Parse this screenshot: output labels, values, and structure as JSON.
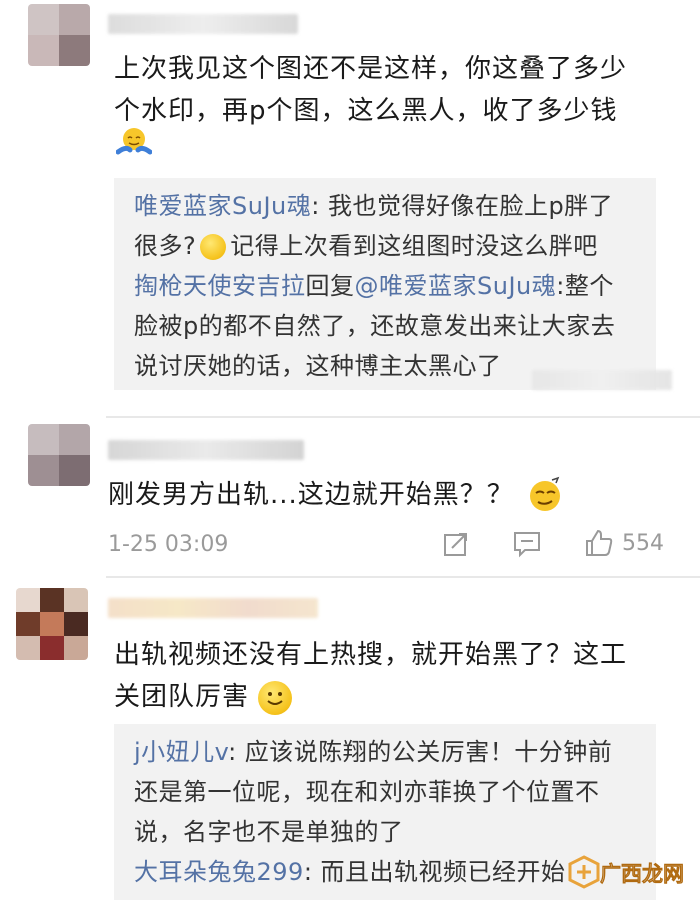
{
  "comment1": {
    "text_line1": "上次我见这个图还不是这样，你这叠了多少",
    "text_line2": "个水印，再p个图，这么黑人，收了多少钱",
    "emoji": "shrug-emoji",
    "replies": [
      {
        "user": "唯爱蓝家SuJu魂",
        "colon": ": ",
        "line1": "我也觉得好像在脸上p胖了",
        "line2a": "很多?",
        "line2b": "记得上次看到这组图时没这么胖吧"
      },
      {
        "user": "掏枪天使安吉拉",
        "mid": "回复",
        "target": "@唯爱蓝家SuJu魂",
        "colon": ":",
        "line1": "整个",
        "line2": "脸被p的都不自然了，还故意发出来让大家去",
        "line3": "说讨厌她的话，这种博主太黑心了"
      }
    ]
  },
  "comment2": {
    "text": "刚发男方出轨...这边就开始黑？？",
    "emoji": "smirk-emoji",
    "timestamp": "1-25 03:09",
    "like_count": "554"
  },
  "comment3": {
    "text_line1": "出轨视频还没有上热搜，就开始黑了？这工",
    "text_line2": "关团队厉害",
    "emoji": "smile-emoji",
    "replies": [
      {
        "user": "j小妞儿v",
        "colon": ": ",
        "line1": "应该说陈翔的公关厉害！十分钟前",
        "line2": "还是第一位呢，现在和刘亦菲换了个位置不",
        "line3": "说，名字也不是单独的了"
      },
      {
        "user": "大耳朵兔兔299",
        "colon": ": ",
        "line1": "而且出轨视频已经开始"
      }
    ]
  },
  "watermark": {
    "text": "广西龙网"
  },
  "colors": {
    "username": "#5472a5",
    "meta": "#9a9a9a",
    "reply_bg": "#f2f2f2",
    "watermark": "#e8a33b"
  },
  "icons": {
    "share": "share-icon",
    "comment": "comment-icon",
    "like": "thumbs-up-icon"
  }
}
